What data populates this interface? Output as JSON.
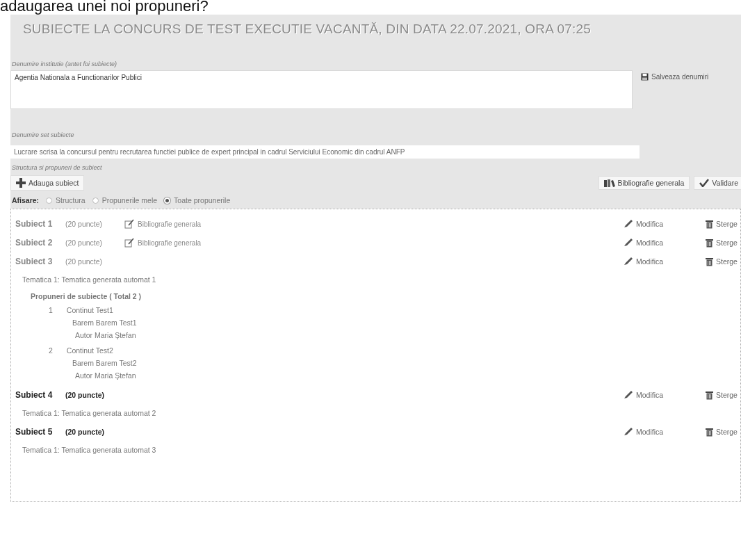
{
  "heading": "adaugarea unei noi propuneri?",
  "title": "SUBIECTE LA CONCURS DE TEST EXECUTIE VACANTĂ, DIN DATA 22.07.2021, ORA 07:25",
  "institution": {
    "label": "Denumire institutie (antet foi subiecte)",
    "value": "Agentia Nationala a Functionarilor Publici",
    "save_button": "Salveaza denumiri"
  },
  "subject_set": {
    "label": "Denumire set subiecte",
    "value": "Lucrare scrisa la concursul pentru recrutarea functiei publice de expert principal in cadrul Serviciului Economic din cadrul ANFP"
  },
  "structure": {
    "label": "Structura si propuneri de subiect",
    "add_button": "Adauga subiect",
    "bibliography_button": "Bibliografie generala",
    "validate_button": "Validare"
  },
  "display": {
    "label": "Afisare:",
    "options": [
      {
        "label": "Structura",
        "selected": false
      },
      {
        "label": "Propunerile mele",
        "selected": false
      },
      {
        "label": "Toate propunerile",
        "selected": true
      }
    ]
  },
  "subjects": [
    {
      "title": "Subiect 1",
      "points": "(20 puncte)",
      "emphasized": false,
      "bibliography": "Bibliografie generala",
      "edit": "Modifica",
      "delete": "Sterge"
    },
    {
      "title": "Subiect 2",
      "points": "(20 puncte)",
      "emphasized": false,
      "bibliography": "Bibliografie generala",
      "edit": "Modifica",
      "delete": "Sterge"
    },
    {
      "title": "Subiect 3",
      "points": "(20 puncte)",
      "emphasized": false,
      "edit": "Modifica",
      "delete": "Sterge",
      "topics": [
        "Tematica 1: Tematica generata automat 1"
      ],
      "proposals": {
        "heading": "Propuneri de subiecte ( Total 2 )",
        "items": [
          {
            "number": "1",
            "content": "Continut Test1",
            "barem": "Barem Barem Test1",
            "author": "Autor Maria Ştefan"
          },
          {
            "number": "2",
            "content": "Continut Test2",
            "barem": "Barem Barem Test2",
            "author": "Autor Maria Ştefan"
          }
        ]
      }
    },
    {
      "title": "Subiect 4",
      "points": "(20 puncte)",
      "emphasized": true,
      "edit": "Modifica",
      "delete": "Sterge",
      "topics": [
        "Tematica 1: Tematica generata automat 2"
      ]
    },
    {
      "title": "Subiect 5",
      "points": "(20 puncte)",
      "emphasized": true,
      "edit": "Modifica",
      "delete": "Sterge",
      "topics": [
        "Tematica 1: Tematica generata automat 3"
      ]
    }
  ]
}
